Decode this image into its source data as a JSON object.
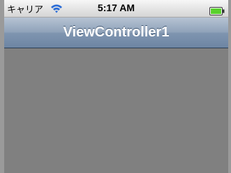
{
  "status_bar": {
    "carrier": "キャリア",
    "time": "5:17 AM",
    "wifi_icon": "wifi-icon",
    "battery_icon": "battery-icon"
  },
  "nav_bar": {
    "title": "ViewController1"
  },
  "colors": {
    "nav_accent": "#6d85a3",
    "content_background": "#808080",
    "battery_fill": "#5ad12e"
  }
}
